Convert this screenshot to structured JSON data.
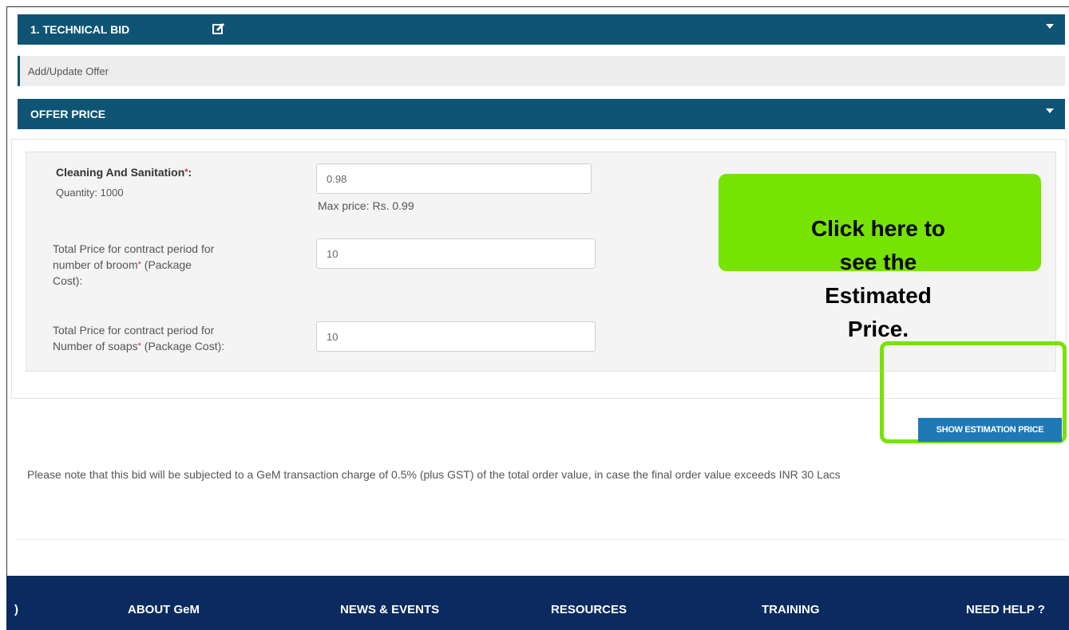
{
  "sections": {
    "technical_bid": "1. TECHNICAL BID",
    "add_update_offer": "Add/Update Offer",
    "offer_price": "OFFER PRICE"
  },
  "items": [
    {
      "label": "Cleaning And Sanitation",
      "quantity": "Quantity: 1000",
      "value": "0.98",
      "max_price": "Max price: Rs. 0.99"
    },
    {
      "label_line1": "Total Price for contract period for",
      "label_line2": "number of broom",
      "label_line2b": " (Package",
      "label_line3": "Cost):",
      "value": "10"
    },
    {
      "label_line1": "Total Price for contract period for",
      "label_line2": "Number of soaps",
      "label_line2b": " (Package Cost):",
      "value": "10"
    }
  ],
  "callout": {
    "line1": "Click here to",
    "line2": "see the",
    "line3": "Estimated",
    "line4": "Price."
  },
  "buttons": {
    "show_estimation": "SHOW ESTIMATION PRICE"
  },
  "note": "Please note that this bid will be subjected to a GeM transaction charge of 0.5% (plus GST) of the total order value, in case the final order value exceeds INR 30 Lacs",
  "footer": {
    "partial": ")",
    "about": "ABOUT GeM",
    "news": "NEWS & EVENTS",
    "resources": "RESOURCES",
    "training": "TRAINING",
    "help": "NEED HELP ?"
  },
  "colors": {
    "header_bar": "#0f5474",
    "callout": "#76e300",
    "button": "#1f79b6",
    "footer": "#0b2a5f"
  }
}
